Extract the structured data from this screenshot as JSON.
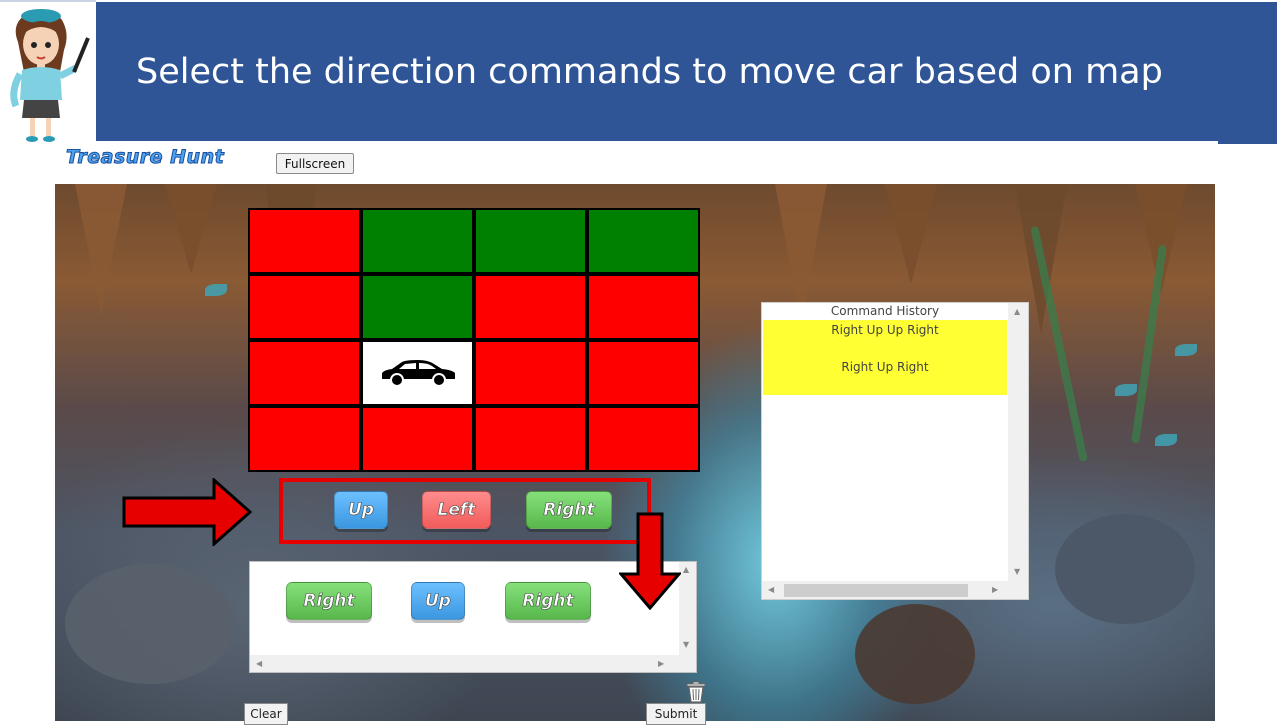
{
  "header": {
    "title": "Select the direction commands to move car based on map"
  },
  "app": {
    "title": "Treasure Hunt",
    "fullscreen_label": "Fullscreen"
  },
  "grid": {
    "rows": [
      [
        "red",
        "green",
        "green",
        "green"
      ],
      [
        "red",
        "green",
        "red",
        "red"
      ],
      [
        "red",
        "car",
        "red",
        "red"
      ],
      [
        "red",
        "red",
        "red",
        "red"
      ]
    ]
  },
  "palette": {
    "up_label": "Up",
    "left_label": "Left",
    "right_label": "Right"
  },
  "program": {
    "commands": [
      "Right",
      "Up",
      "Right"
    ]
  },
  "history": {
    "title": "Command History",
    "entries": [
      "Right Up Up Right",
      "Right Up Right"
    ]
  },
  "actions": {
    "clear_label": "Clear",
    "submit_label": "Submit"
  },
  "colors": {
    "banner": "#2f5597",
    "cell_red": "#ff0000",
    "cell_green": "#008000",
    "highlight": "#ffff33",
    "arrow": "#e60000"
  }
}
